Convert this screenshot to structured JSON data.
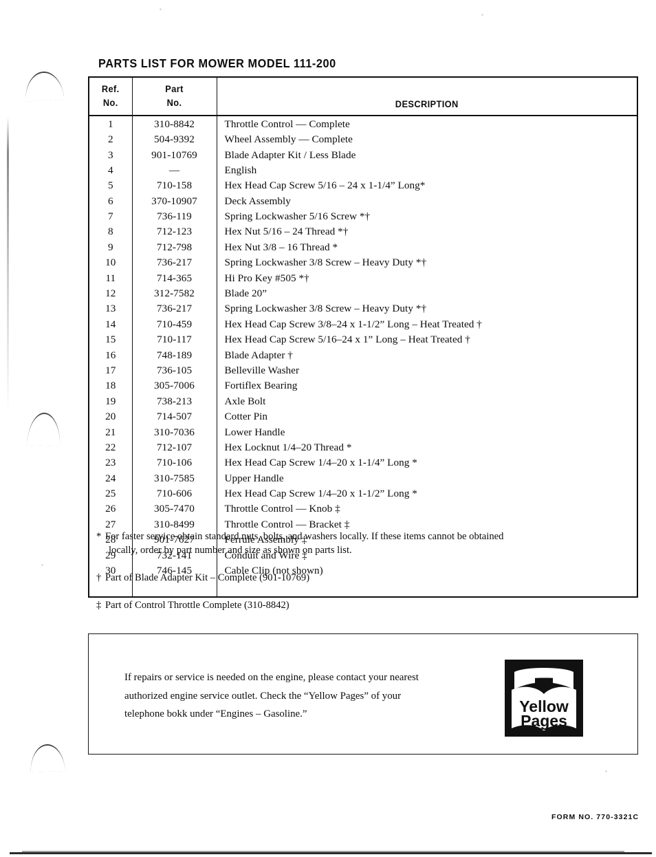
{
  "document": {
    "title": "PARTS LIST FOR MOWER MODEL 111-200",
    "form_number": "FORM NO. 770-3321C"
  },
  "table": {
    "headers": {
      "ref_line1": "Ref.",
      "ref_line2": "No.",
      "part_line1": "Part",
      "part_line2": "No.",
      "description": "DESCRIPTION"
    },
    "rows": [
      {
        "ref": "1",
        "part": "310-8842",
        "description": "Throttle Control — Complete"
      },
      {
        "ref": "2",
        "part": "504-9392",
        "description": "Wheel Assembly — Complete"
      },
      {
        "ref": "3",
        "part": "901-10769",
        "description": "Blade Adapter Kit / Less Blade"
      },
      {
        "ref": "4",
        "part": "—",
        "description": "English"
      },
      {
        "ref": "5",
        "part": "710-158",
        "description": "Hex Head Cap Screw 5/16 – 24 x 1-1/4” Long*"
      },
      {
        "ref": "6",
        "part": "370-10907",
        "description": "Deck Assembly"
      },
      {
        "ref": "7",
        "part": "736-119",
        "description": "Spring Lockwasher 5/16 Screw *†"
      },
      {
        "ref": "8",
        "part": "712-123",
        "description": "Hex Nut 5/16 – 24 Thread *†"
      },
      {
        "ref": "9",
        "part": "712-798",
        "description": "Hex Nut 3/8 – 16 Thread *"
      },
      {
        "ref": "10",
        "part": "736-217",
        "description": "Spring Lockwasher 3/8 Screw – Heavy Duty *†"
      },
      {
        "ref": "11",
        "part": "714-365",
        "description": "Hi Pro Key #505 *†"
      },
      {
        "ref": "12",
        "part": "312-7582",
        "description": "Blade 20”"
      },
      {
        "ref": "13",
        "part": "736-217",
        "description": "Spring Lockwasher 3/8 Screw – Heavy Duty *†"
      },
      {
        "ref": "14",
        "part": "710-459",
        "description": "Hex Head Cap Screw 3/8–24 x 1-1/2” Long – Heat Treated †"
      },
      {
        "ref": "15",
        "part": "710-117",
        "description": "Hex Head Cap Screw 5/16–24 x 1” Long – Heat Treated †"
      },
      {
        "ref": "16",
        "part": "748-189",
        "description": "Blade Adapter †"
      },
      {
        "ref": "17",
        "part": "736-105",
        "description": "Belleville Washer"
      },
      {
        "ref": "18",
        "part": "305-7006",
        "description": "Fortiflex Bearing"
      },
      {
        "ref": "19",
        "part": "738-213",
        "description": "Axle Bolt"
      },
      {
        "ref": "20",
        "part": "714-507",
        "description": "Cotter Pin"
      },
      {
        "ref": "21",
        "part": "310-7036",
        "description": "Lower Handle"
      },
      {
        "ref": "22",
        "part": "712-107",
        "description": "Hex Locknut 1/4–20 Thread *"
      },
      {
        "ref": "23",
        "part": "710-106",
        "description": "Hex Head Cap Screw 1/4–20 x 1-1/4” Long *"
      },
      {
        "ref": "24",
        "part": "310-7585",
        "description": "Upper Handle"
      },
      {
        "ref": "25",
        "part": "710-606",
        "description": "Hex Head Cap Screw 1/4–20 x 1-1/2” Long *"
      },
      {
        "ref": "26",
        "part": "305-7470",
        "description": "Throttle Control — Knob ‡"
      },
      {
        "ref": "27",
        "part": "310-8499",
        "description": "Throttle Control — Bracket ‡"
      },
      {
        "ref": "28",
        "part": "901-7627",
        "description": "Ferrule Assembly ‡"
      },
      {
        "ref": "29",
        "part": "732-141",
        "description": "Conduit and Wire ‡"
      },
      {
        "ref": "30",
        "part": "746-145",
        "description": "Cable Clip (not shown)"
      }
    ]
  },
  "footnotes": [
    {
      "mark": "*",
      "line1": "For faster service obtain standard nuts, bolts, and washers locally.  If these items cannot be obtained",
      "line2": "locally, order by part number and size as shown on parts list."
    },
    {
      "mark": "†",
      "line1": "Part of Blade Adapter Kit – Complete  (901-10769)"
    },
    {
      "mark": "‡",
      "line1": "Part of Control Throttle Complete (310-8842)"
    }
  ],
  "notice": {
    "line1": "If repairs or service is needed on the engine, please contact your nearest",
    "line2": "authorized  engine  service  outlet.  Check  the  “Yellow  Pages”  of your",
    "line3": "telephone bokk under “Engines – Gasoline.”",
    "logo": {
      "name": "yellow-pages-logo",
      "word1": "Yellow",
      "word2": "Pages",
      "background_color": "#111111",
      "foreground_color": "#ffffff"
    }
  }
}
